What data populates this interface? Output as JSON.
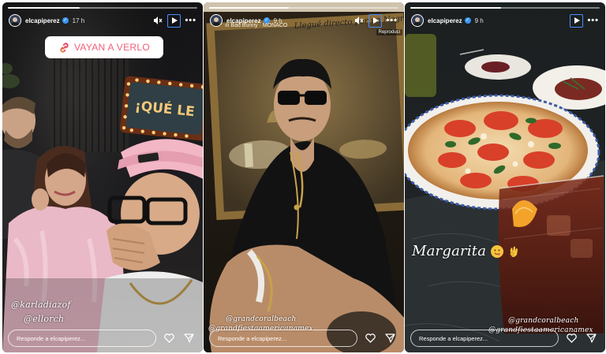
{
  "stories": [
    {
      "username": "elcapiperez",
      "time": "17 h",
      "progress": 0.38,
      "link_sticker": "VAYAN A VERLO",
      "neon_sign": "¡QUÉ LE",
      "mentions": [
        "@karladiazof",
        "@ellorch"
      ],
      "reply_placeholder": "Responde a elcapiperez...",
      "icons": {
        "mute": "mute-icon",
        "play": "play-icon",
        "more": "more-icon",
        "like": "heart-icon",
        "share": "send-icon",
        "link": "link-icon"
      }
    },
    {
      "username": "elcapiperez",
      "time": "9 h",
      "progress": 0.42,
      "music": "Bad Bunny · MONACO",
      "tooltip": "Reproduci",
      "caption": "Llegué directo por un Negroni",
      "mentions": [
        "@grandcoralbeach",
        "@grandfiestaamericanamex"
      ],
      "reply_placeholder": "Responde a elcapiperez...",
      "icons": {
        "mute": "mute-icon",
        "play": "play-icon",
        "more": "more-icon",
        "like": "heart-icon",
        "share": "send-icon"
      }
    },
    {
      "username": "elcapiperez",
      "time": "9 h",
      "progress": 0.48,
      "caption": "Margarita",
      "mentions": [
        "@grandcoralbeach",
        "@grandfiestaamericanamex"
      ],
      "reply_placeholder": "Responde a elcapiperez...",
      "icons": {
        "play": "play-icon",
        "more": "more-icon",
        "like": "heart-icon",
        "share": "send-icon",
        "emoji": "savoring-face-emoji",
        "hand": "ok-hand-emoji"
      }
    }
  ],
  "colors": {
    "accent_play_border": "#4a8dff",
    "sticker_text": "#f0607a",
    "verified": "#3897f0"
  }
}
